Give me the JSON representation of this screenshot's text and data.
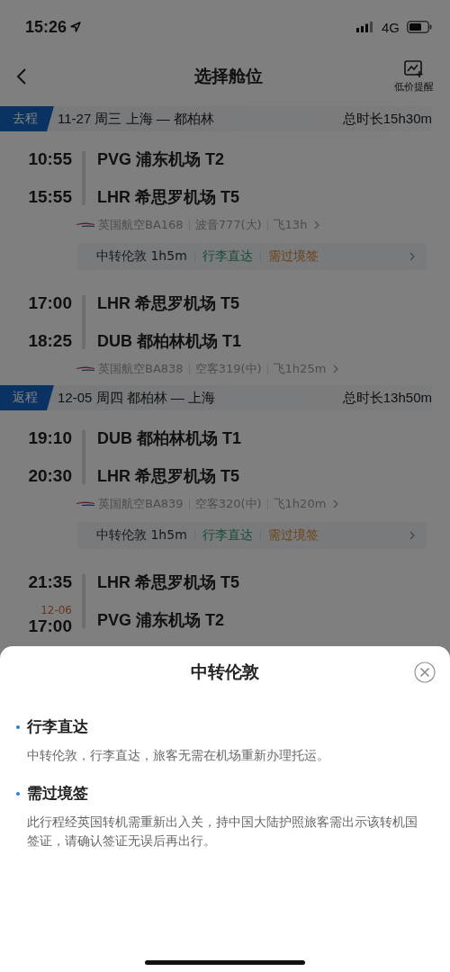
{
  "status_bar": {
    "time": "15:26",
    "network": "4G"
  },
  "nav": {
    "title": "选择舱位",
    "action": "低价提醒"
  },
  "trips": [
    {
      "label": "去程",
      "route": "11-27 周三 上海 — 都柏林",
      "duration": "总时长15h30m",
      "items": [
        {
          "kind": "segment",
          "dep_time": "10:55",
          "dep_airport": "PVG 浦东机场 T2",
          "arr_time": "15:55",
          "arr_airport": "LHR 希思罗机场 T5",
          "airline": "英国航空BA168",
          "aircraft": "波音777(大)",
          "flight_time": "飞13h"
        },
        {
          "kind": "transfer",
          "text": "中转伦敦 1h5m",
          "tags": [
            {
              "text": "行李直达",
              "kind": "baggage"
            },
            {
              "text": "需过境签",
              "kind": "visa"
            }
          ]
        },
        {
          "kind": "segment",
          "dep_time": "17:00",
          "dep_airport": "LHR 希思罗机场 T5",
          "arr_time": "18:25",
          "arr_airport": "DUB 都柏林机场 T1",
          "airline": "英国航空BA838",
          "aircraft": "空客319(中)",
          "flight_time": "飞1h25m"
        }
      ]
    },
    {
      "label": "返程",
      "route": "12-05 周四 都柏林 — 上海",
      "duration": "总时长13h50m",
      "items": [
        {
          "kind": "segment",
          "dep_time": "19:10",
          "dep_airport": "DUB 都柏林机场 T1",
          "arr_time": "20:30",
          "arr_airport": "LHR 希思罗机场 T5",
          "airline": "英国航空BA839",
          "aircraft": "空客320(中)",
          "flight_time": "飞1h20m"
        },
        {
          "kind": "transfer",
          "text": "中转伦敦 1h5m",
          "tags": [
            {
              "text": "行李直达",
              "kind": "baggage"
            },
            {
              "text": "需过境签",
              "kind": "visa"
            }
          ]
        },
        {
          "kind": "segment",
          "dep_time": "21:35",
          "dep_airport": "LHR 希思罗机场 T5",
          "arr_date": "12-06",
          "arr_time": "17:00",
          "arr_airport": "PVG 浦东机场 T2"
        }
      ]
    }
  ],
  "sheet": {
    "title": "中转伦敦",
    "sections": [
      {
        "heading": "行李直达",
        "body": "中转伦敦，行李直达，旅客无需在机场重新办理托运。"
      },
      {
        "heading": "需过境签",
        "body": "此行程经英国转机需重新出入关，持中国大陆护照旅客需出示该转机国签证，请确认签证无误后再出行。"
      }
    ]
  }
}
